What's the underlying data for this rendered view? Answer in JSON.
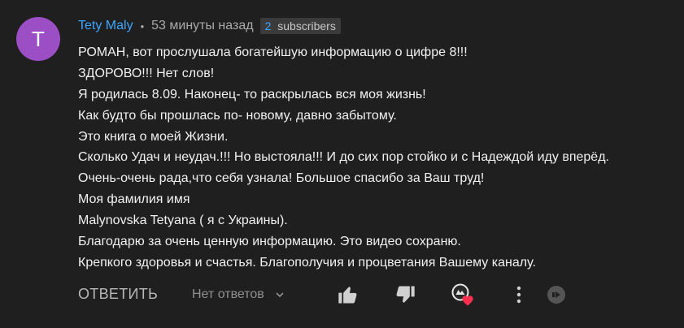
{
  "avatar": {
    "letter": "T",
    "color": "#9c4fc4"
  },
  "author": "Tety Maly",
  "separator": "•",
  "time_ago": "53 минуты назад",
  "badge": {
    "count": "2",
    "label": "subscribers"
  },
  "comment_lines": [
    "РОМАН, вот прослушала богатейшую информацию о цифре 8!!!",
    "ЗДОРОВО!!! Нет слов!",
    "Я родилась 8.09. Наконец- то раскрылась вся моя жизнь!",
    "Как будто бы прошлась по- новому, давно забытому.",
    "Это книга о моей Жизни.",
    "Сколько Удач и неудач.!!! Но выстояла!!! И до сих пор стойко и с Надеждой иду вперёд.",
    "Очень-очень рада,что себя узнала! Большое спасибо за Ваш труд!",
    "Моя фамилия имя",
    "Malynovska Tetyana ( я с Украины).",
    "Благодарю за очень ценную информацию. Это видео сохраню.",
    "Крепкого здоровья и счастья. Благополучия и процветания Вашему каналу."
  ],
  "actions": {
    "reply_label": "ОТВЕТИТЬ",
    "replies_label": "Нет ответов"
  },
  "icons": [
    "chevron-down-icon",
    "thumbs-up-icon",
    "thumbs-down-icon",
    "creator-heart-icon",
    "more-vert-icon",
    "creator-badge-icon"
  ],
  "colors": {
    "background": "#1f1f1f",
    "author": "#3ea6ff",
    "text": "#f1f1f1",
    "muted": "#aaaaaa",
    "heart": "#ff2f4f"
  }
}
